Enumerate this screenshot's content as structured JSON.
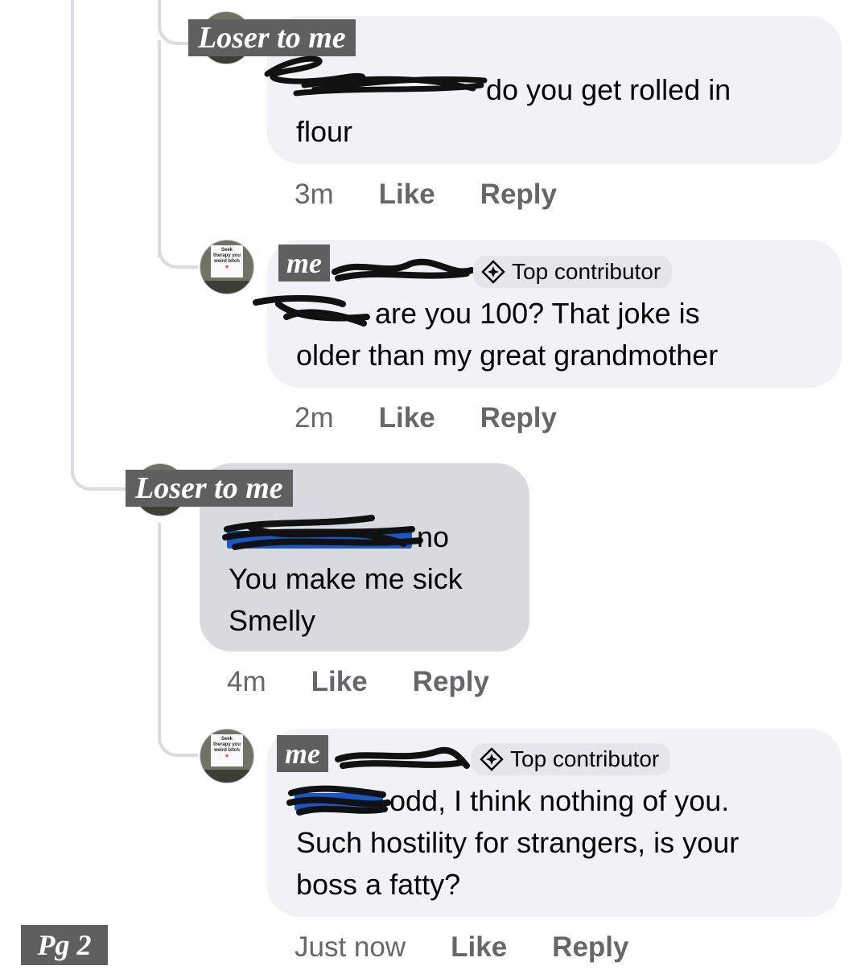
{
  "comments": [
    {
      "author_tag": "Loser to me",
      "lines": [
        "do you get rolled in",
        "flour"
      ],
      "time": "3m",
      "like": "Like",
      "reply": "Reply"
    },
    {
      "author_tag": "me",
      "badge": "Top contributor",
      "lines": [
        "are you 100? That joke is",
        "older than my great grandmother"
      ],
      "time": "2m",
      "like": "Like",
      "reply": "Reply",
      "avatar_sign": [
        "Seek",
        "therapy you",
        "weird bitch"
      ]
    },
    {
      "author_tag": "Loser to me",
      "lines": [
        "no",
        "You make me sick",
        "Smelly"
      ],
      "time": "4m",
      "like": "Like",
      "reply": "Reply"
    },
    {
      "author_tag": "me",
      "badge": "Top contributor",
      "lines": [
        "odd, I think nothing of you.",
        "Such hostility for strangers, is your",
        "boss a fatty?"
      ],
      "time": "Just now",
      "like": "Like",
      "reply": "Reply",
      "avatar_sign": [
        "Seek",
        "therapy you",
        "weird bitch"
      ]
    }
  ],
  "page_label": "Pg 2",
  "colors": {
    "bubble": "#f0f2f5",
    "bubble_highlight": "#d8dadf",
    "tag_bg": "#5f5f5f",
    "meta_text": "#65676b",
    "mention_blue": "#1b56c7"
  }
}
